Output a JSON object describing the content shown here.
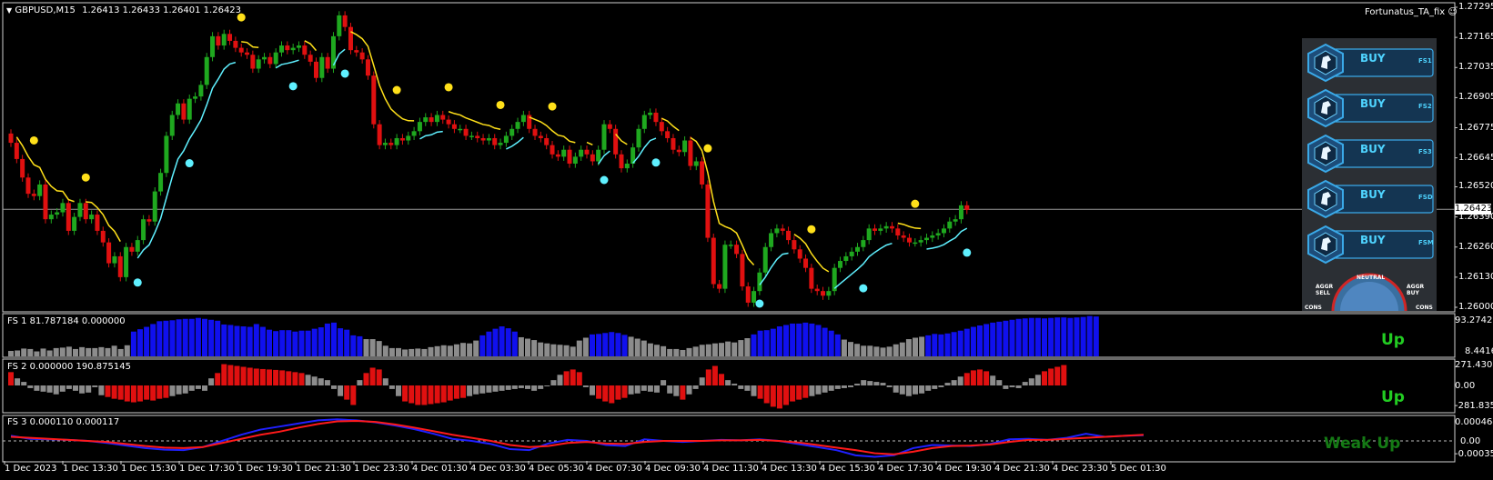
{
  "header": {
    "symbol_label": "GBPUSD,M15",
    "ohlc": "1.26413 1.26433 1.26401 1.26423",
    "expert_name": "Fortunatus_TA_fix"
  },
  "price_axis": {
    "ticks": [
      "1.27295",
      "1.27165",
      "1.27035",
      "1.26905",
      "1.26775",
      "1.26645",
      "1.26520",
      "1.26390",
      "1.26260",
      "1.26130",
      "1.26000"
    ],
    "current_price": "1.26423"
  },
  "panels": [
    {
      "title": "FS 1 81.787184 0.000000",
      "axis": [
        "93.274204",
        "8.441629"
      ],
      "status": "Up"
    },
    {
      "title": "FS 2 0.000000 190.875145",
      "axis": [
        "271.43064",
        "0.00",
        "-281.8352"
      ],
      "status": "Up"
    },
    {
      "title": "FS 3 0.000110 0.000117",
      "axis": [
        "0.000464",
        "0.00",
        "-0.00035"
      ],
      "status": "Weak Up"
    }
  ],
  "time_axis": [
    "1 Dec 2023",
    "1 Dec 13:30",
    "1 Dec 15:30",
    "1 Dec 17:30",
    "1 Dec 19:30",
    "1 Dec 21:30",
    "1 Dec 23:30",
    "4 Dec 01:30",
    "4 Dec 03:30",
    "4 Dec 05:30",
    "4 Dec 07:30",
    "4 Dec 09:30",
    "4 Dec 11:30",
    "4 Dec 13:30",
    "4 Dec 15:30",
    "4 Dec 17:30",
    "4 Dec 19:30",
    "4 Dec 21:30",
    "4 Dec 23:30",
    "5 Dec 01:30"
  ],
  "signal_panel": {
    "buttons": [
      {
        "label": "BUY",
        "tag": "FS1"
      },
      {
        "label": "BUY",
        "tag": "FS2"
      },
      {
        "label": "BUY",
        "tag": "FS3"
      },
      {
        "label": "BUY",
        "tag": "FSD"
      },
      {
        "label": "BUY",
        "tag": "FSM"
      }
    ],
    "gauge": {
      "neutral": "NEUTRAL",
      "aggr_sell": "AGGR\nSELL",
      "aggr_buy": "AGGR\nBUY",
      "cons_left": "CONS",
      "cons_right": "CONS"
    }
  },
  "colors": {
    "bull": "#1fa81f",
    "bear": "#e01010",
    "yellow": "#ffe01a",
    "cyan": "#5ff0ff",
    "fs_blue": "#1010ee",
    "fs_gray": "#8c8c8c",
    "status_green": "#22cc22",
    "status_dim": "#157a15"
  },
  "chart_data": [
    {
      "type": "candlestick",
      "title": "GBPUSD,M15",
      "ylim": [
        1.26,
        1.27295
      ],
      "close": [
        1.2671,
        1.2664,
        1.2656,
        1.2649,
        1.2648,
        1.2653,
        1.2638,
        1.264,
        1.2641,
        1.2645,
        1.2633,
        1.2639,
        1.2645,
        1.2638,
        1.264,
        1.2633,
        1.2628,
        1.2619,
        1.2622,
        1.2613,
        1.2626,
        1.2624,
        1.2629,
        1.2638,
        1.2637,
        1.265,
        1.2658,
        1.2674,
        1.2683,
        1.2688,
        1.2681,
        1.269,
        1.2691,
        1.2696,
        1.2708,
        1.2717,
        1.2713,
        1.2718,
        1.2715,
        1.2712,
        1.271,
        1.2709,
        1.2703,
        1.2707,
        1.2708,
        1.2705,
        1.271,
        1.2713,
        1.2711,
        1.2712,
        1.2713,
        1.2709,
        1.2706,
        1.2699,
        1.2708,
        1.2703,
        1.2717,
        1.2726,
        1.2721,
        1.2711,
        1.271,
        1.2707,
        1.27,
        1.2679,
        1.267,
        1.2671,
        1.267,
        1.2673,
        1.2672,
        1.2674,
        1.2676,
        1.268,
        1.2682,
        1.268,
        1.2683,
        1.2681,
        1.2679,
        1.2677,
        1.2677,
        1.2674,
        1.2674,
        1.2673,
        1.2672,
        1.2673,
        1.267,
        1.2671,
        1.2674,
        1.2677,
        1.268,
        1.2683,
        1.2677,
        1.2674,
        1.2673,
        1.267,
        1.2666,
        1.2665,
        1.2668,
        1.2662,
        1.2665,
        1.2668,
        1.2666,
        1.2663,
        1.2668,
        1.2679,
        1.2677,
        1.2666,
        1.266,
        1.2662,
        1.2669,
        1.2677,
        1.2683,
        1.2684,
        1.268,
        1.2676,
        1.2673,
        1.2668,
        1.2667,
        1.2672,
        1.2661,
        1.2663,
        1.2653,
        1.263,
        1.261,
        1.2608,
        1.2627,
        1.2627,
        1.2623,
        1.2609,
        1.2602,
        1.2607,
        1.2615,
        1.2626,
        1.2632,
        1.2634,
        1.2633,
        1.2629,
        1.2625,
        1.2621,
        1.2617,
        1.2608,
        1.2607,
        1.2605,
        1.2607,
        1.2617,
        1.262,
        1.2622,
        1.2624,
        1.2626,
        1.2629,
        1.2634,
        1.2633,
        1.2634,
        1.2635,
        1.2634,
        1.2631,
        1.263,
        1.2628,
        1.2628,
        1.2629,
        1.263,
        1.2631,
        1.2632,
        1.2634,
        1.2637,
        1.2638,
        1.2644,
        1.2642
      ]
    },
    {
      "type": "bar",
      "title": "FS 1 81.787184 0.000000",
      "ylim": [
        8.441629,
        93.274204
      ],
      "values": [
        20,
        21,
        25,
        24,
        19,
        25,
        21,
        26,
        27,
        29,
        24,
        28,
        26,
        26,
        28,
        26,
        31,
        24,
        32,
        61,
        66,
        71,
        77,
        83,
        84,
        85,
        87,
        88,
        88,
        90,
        88,
        86,
        84,
        76,
        75,
        73,
        72,
        71,
        77,
        71,
        65,
        62,
        64,
        64,
        61,
        63,
        63,
        67,
        70,
        78,
        80,
        68,
        65,
        53,
        51,
        45,
        45,
        41,
        31,
        26,
        26,
        23,
        24,
        25,
        24,
        28,
        30,
        32,
        31,
        34,
        37,
        36,
        42,
        53,
        61,
        67,
        72,
        68,
        61,
        49,
        46,
        43,
        38,
        36,
        34,
        33,
        32,
        29,
        42,
        48,
        55,
        56,
        58,
        60,
        58,
        54,
        50,
        46,
        42,
        36,
        33,
        30,
        24,
        24,
        22,
        26,
        29,
        33,
        34,
        36,
        37,
        40,
        38,
        43,
        47,
        55,
        63,
        64,
        67,
        72,
        75,
        78,
        78,
        80,
        78,
        75,
        69,
        63,
        55,
        44,
        39,
        35,
        31,
        31,
        29,
        27,
        29,
        34,
        38,
        45,
        48,
        50,
        53,
        56,
        55,
        57,
        60,
        63,
        67,
        71,
        74,
        77,
        80,
        82,
        84,
        86,
        88,
        89,
        90,
        90,
        89,
        90,
        91,
        91,
        90,
        91,
        92,
        94,
        93
      ]
    },
    {
      "type": "bar",
      "title": "FS 2 0.000000 190.875145",
      "ylim": [
        -281.8352,
        271.43064
      ],
      "values": [
        150,
        80,
        40,
        -30,
        -60,
        -70,
        -80,
        -100,
        -70,
        -40,
        -60,
        -90,
        -80,
        -20,
        -110,
        -130,
        -150,
        -160,
        -180,
        -190,
        -180,
        -160,
        -170,
        -150,
        -140,
        -120,
        -100,
        -90,
        -60,
        -40,
        -60,
        80,
        140,
        240,
        230,
        220,
        210,
        200,
        190,
        185,
        180,
        175,
        170,
        160,
        150,
        140,
        120,
        100,
        80,
        60,
        -40,
        -120,
        -160,
        -220,
        60,
        140,
        200,
        180,
        80,
        -40,
        -120,
        -180,
        -200,
        -220,
        -220,
        -210,
        -200,
        -190,
        -170,
        -150,
        -140,
        -120,
        -100,
        -90,
        -80,
        -70,
        -60,
        -50,
        -40,
        -30,
        -40,
        -60,
        -40,
        -10,
        60,
        120,
        160,
        180,
        150,
        -20,
        -110,
        -150,
        -180,
        -200,
        -160,
        -140,
        -100,
        -90,
        -60,
        -70,
        -80,
        60,
        -90,
        -120,
        -160,
        -100,
        -40,
        90,
        180,
        220,
        130,
        60,
        20,
        -40,
        -60,
        -120,
        -150,
        -200,
        -240,
        -260,
        -220,
        -180,
        -160,
        -140,
        -120,
        -100,
        -80,
        -60,
        -40,
        -30,
        -20,
        20,
        60,
        50,
        40,
        30,
        -20,
        -80,
        -100,
        -120,
        -100,
        -90,
        -60,
        -40,
        -20,
        30,
        60,
        100,
        140,
        170,
        180,
        160,
        110,
        60,
        -40,
        -20,
        -30,
        40,
        80,
        120,
        160,
        190,
        210,
        230
      ]
    },
    {
      "type": "line",
      "title": "FS 3 0.000110 0.000117",
      "ylim": [
        -0.00035,
        0.000464
      ],
      "series": [
        {
          "color": "blue",
          "values": [
            0.0001,
            4e-05,
            3e-05,
            2e-05,
            0.0,
            -4e-05,
            -9e-05,
            -0.00014,
            -0.00017,
            -0.00018,
            -0.00012,
            0.0,
            0.00012,
            0.00022,
            0.00028,
            0.00034,
            0.0004,
            0.00042,
            0.0004,
            0.00036,
            0.0003,
            0.00023,
            0.00014,
            4e-05,
            0.0,
            -6e-05,
            -0.00016,
            -0.00018,
            -5e-05,
            2e-05,
            0.0,
            -8e-05,
            -0.0001,
            3e-05,
            0.0,
            -2e-05,
            0.0,
            2e-05,
            1e-05,
            3e-05,
            0.0,
            -6e-05,
            -0.00012,
            -0.00018,
            -0.00028,
            -0.00031,
            -0.00028,
            -0.00014,
            -8e-05,
            -9e-05,
            -0.0001,
            -6e-05,
            3e-05,
            4e-05,
            2e-05,
            6e-05,
            0.00014,
            8e-05,
            0.0001,
            0.00011
          ]
        },
        {
          "color": "red",
          "values": [
            8e-05,
            6e-05,
            4e-05,
            2e-05,
            0.0,
            -2e-05,
            -6e-05,
            -0.0001,
            -0.00013,
            -0.00014,
            -0.00012,
            -4e-05,
            4e-05,
            0.00012,
            0.00018,
            0.00026,
            0.00033,
            0.00038,
            0.00039,
            0.00037,
            0.00032,
            0.00026,
            0.00019,
            0.00012,
            6e-05,
            0.0,
            -8e-05,
            -0.00012,
            -0.0001,
            -4e-05,
            -2e-05,
            -5e-05,
            -6e-05,
            -2e-05,
            0.0,
            0.0,
            0.0,
            1e-05,
            1e-05,
            2e-05,
            0.0,
            -3e-05,
            -8e-05,
            -0.00013,
            -0.00018,
            -0.00024,
            -0.00026,
            -0.00021,
            -0.00014,
            -0.0001,
            -9e-05,
            -7e-05,
            -2e-05,
            2e-05,
            2e-05,
            4e-05,
            6e-05,
            8e-05,
            0.0001,
            0.00012
          ]
        }
      ]
    }
  ]
}
